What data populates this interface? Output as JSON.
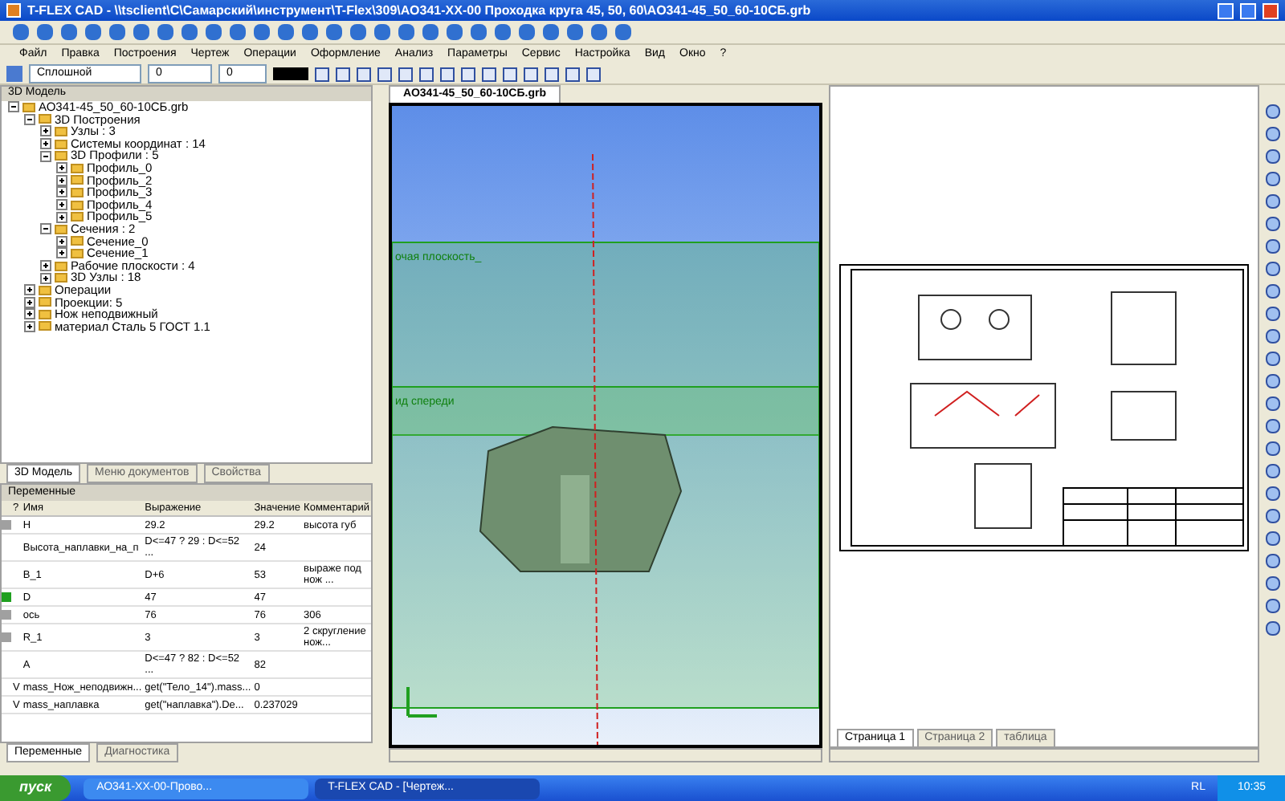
{
  "window": {
    "title": "T-FLEX CAD - \\\\tsclient\\C\\Самарский\\инструмент\\T-Flex\\309\\АО341-ХХ-00 Проходка круга 45, 50, 60\\АО341-45_50_60-10СБ.grb"
  },
  "menu": [
    "Файл",
    "Правка",
    "Построения",
    "Чертеж",
    "Операции",
    "Оформление",
    "Анализ",
    "Параметры",
    "Сервис",
    "Настройка",
    "Вид",
    "Окно",
    "?"
  ],
  "style_toolbar": {
    "line_type": "Сплошной",
    "layer": "0",
    "level": "0"
  },
  "model_panel": {
    "title": "3D Модель",
    "tree": [
      {
        "label": "АО341-45_50_60-10СБ.grb",
        "expanded": true,
        "children": [
          {
            "label": "3D Построения",
            "expanded": true,
            "children": [
              {
                "label": "Узлы : 3",
                "expanded": false
              },
              {
                "label": "Системы координат : 14",
                "expanded": false
              },
              {
                "label": "3D Профили : 5",
                "expanded": true,
                "children": [
                  {
                    "label": "Профиль_0",
                    "expanded": false
                  },
                  {
                    "label": "Профиль_2",
                    "expanded": false
                  },
                  {
                    "label": "Профиль_3",
                    "expanded": false
                  },
                  {
                    "label": "Профиль_4",
                    "expanded": false
                  },
                  {
                    "label": "Профиль_5",
                    "expanded": false
                  }
                ]
              },
              {
                "label": "Сечения : 2",
                "expanded": true,
                "children": [
                  {
                    "label": "Сечение_0",
                    "expanded": false
                  },
                  {
                    "label": "Сечение_1",
                    "expanded": false
                  }
                ]
              },
              {
                "label": "Рабочие плоскости : 4",
                "expanded": false
              },
              {
                "label": "3D Узлы : 18",
                "expanded": false
              }
            ]
          },
          {
            "label": "Операции",
            "expanded": false
          },
          {
            "label": "Проекции: 5",
            "expanded": false
          },
          {
            "label": "Нож неподвижный",
            "expanded": false
          },
          {
            "label": "материал Сталь 5 ГОСТ 1.1",
            "expanded": false
          }
        ]
      }
    ]
  },
  "panel_tabs": [
    {
      "label": "3D Модель",
      "selected": true
    },
    {
      "label": "Меню документов",
      "selected": false
    },
    {
      "label": "Свойства",
      "selected": false
    }
  ],
  "variables": {
    "title": "Переменные",
    "columns": [
      "?",
      "Имя",
      "Выражение",
      "Значение",
      "Комментарий"
    ],
    "rows": [
      {
        "color": "#a0a0a0",
        "flag": "",
        "name": "H",
        "expression": "29.2",
        "value": "29.2",
        "comment": "высота губ"
      },
      {
        "flag": "",
        "name": "Высота_наплавки_на_п",
        "expression": "D<=47 ? 29 : D<=52 ...",
        "value": "24",
        "comment": ""
      },
      {
        "flag": "",
        "name": "В_1",
        "expression": "D+6",
        "value": "53",
        "comment": "выраже под нож ..."
      },
      {
        "color": "#20a020",
        "flag": "",
        "name": "D",
        "expression": "47",
        "value": "47",
        "comment": ""
      },
      {
        "color": "#a0a0a0",
        "flag": "",
        "name": "ось",
        "expression": "76",
        "value": "76",
        "comment": "306"
      },
      {
        "color": "#a0a0a0",
        "flag": "",
        "name": "R_1",
        "expression": "3",
        "value": "3",
        "comment": "2 скругление нож..."
      },
      {
        "flag": "",
        "name": "A",
        "expression": "D<=47 ? 82 : D<=52 ...",
        "value": "82",
        "comment": ""
      },
      {
        "flag": "V",
        "name": "mass_Нож_неподвижн...",
        "expression": "get(\"Тело_14\").mass...",
        "value": "0",
        "comment": ""
      },
      {
        "flag": "V",
        "name": "mass_наплавка",
        "expression": "get(\"наплавка\").De...",
        "value": "0.237029",
        "comment": ""
      }
    ]
  },
  "bottom_tabs": [
    {
      "label": "Переменные",
      "selected": true
    },
    {
      "label": "Диагностика",
      "selected": false
    }
  ],
  "viewport": {
    "tab": "АО341-45_50_60-10СБ.grb",
    "labels": [
      "очая плоскость_",
      "ид спереди"
    ]
  },
  "sheet_tabs": [
    {
      "label": "Страница 1",
      "selected": true
    },
    {
      "label": "Страница 2",
      "selected": false
    },
    {
      "label": "таблица",
      "selected": false
    }
  ],
  "taskbar": {
    "start": "пуск",
    "tasks": [
      {
        "label": "АО341-ХХ-00-Прово...",
        "selected": false
      },
      {
        "label": "T-FLEX CAD - [Чертеж...",
        "selected": true
      }
    ],
    "language": "RL",
    "clock": "10:35"
  }
}
